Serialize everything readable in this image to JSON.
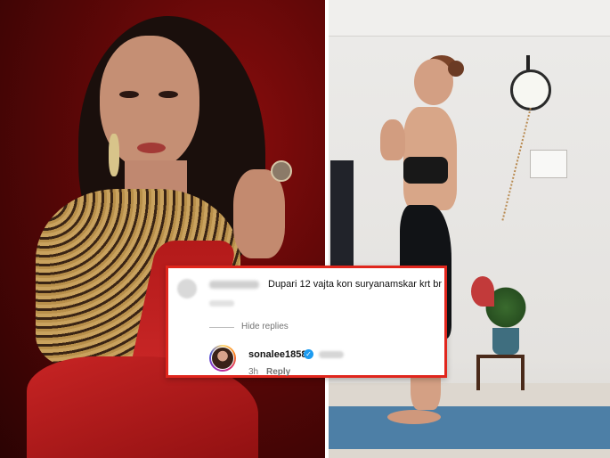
{
  "comment": {
    "text": "Dupari 12 vajta kon suryanamskar krt br"
  },
  "thread": {
    "hide_replies_label": "Hide replies"
  },
  "reply": {
    "username": "sonalee18588",
    "verified_glyph": "✓",
    "time": "3h",
    "reply_label": "Reply"
  },
  "colors": {
    "highlight_border": "#e0261d",
    "verified": "#1d9bf0"
  }
}
